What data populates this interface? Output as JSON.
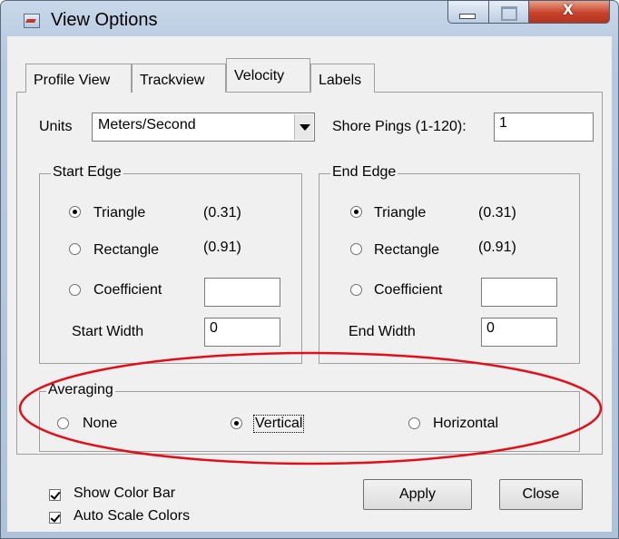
{
  "window": {
    "title": "View Options"
  },
  "tabs": [
    {
      "label": "Profile View",
      "active": false
    },
    {
      "label": "Trackview",
      "active": false
    },
    {
      "label": "Velocity",
      "active": true
    },
    {
      "label": "Labels",
      "active": false
    }
  ],
  "units": {
    "label": "Units",
    "value": "Meters/Second"
  },
  "shore_pings": {
    "label": "Shore Pings (1-120):",
    "value": "1"
  },
  "start_edge": {
    "title": "Start Edge",
    "options": [
      {
        "label": "Triangle",
        "value": "(0.31)",
        "checked": true
      },
      {
        "label": "Rectangle",
        "value": "(0.91)",
        "checked": false
      },
      {
        "label": "Coefficient",
        "value": "",
        "checked": false
      }
    ],
    "width_label": "Start Width",
    "width_value": "0"
  },
  "end_edge": {
    "title": "End Edge",
    "options": [
      {
        "label": "Triangle",
        "value": "(0.31)",
        "checked": true
      },
      {
        "label": "Rectangle",
        "value": "(0.91)",
        "checked": false
      },
      {
        "label": "Coefficient",
        "value": "",
        "checked": false
      }
    ],
    "width_label": "End Width",
    "width_value": "0"
  },
  "averaging": {
    "title": "Averaging",
    "options": [
      {
        "label": "None",
        "checked": false
      },
      {
        "label": "Vertical",
        "checked": true
      },
      {
        "label": "Horizontal",
        "checked": false
      }
    ]
  },
  "checkboxes": [
    {
      "label": "Show Color Bar",
      "checked": true
    },
    {
      "label": "Auto Scale Colors",
      "checked": true
    }
  ],
  "buttons": {
    "apply": "Apply",
    "close": "Close"
  },
  "colors": {
    "annotation": "#e0101a",
    "close_button": "#c7432a"
  }
}
